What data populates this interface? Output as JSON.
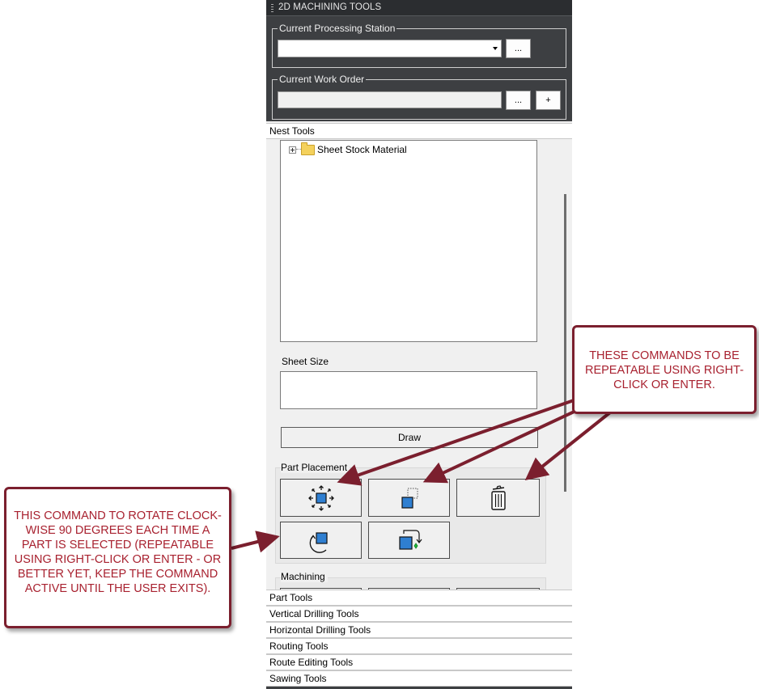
{
  "panel": {
    "title": "2D MACHINING TOOLS",
    "processing_station": {
      "label": "Current Processing Station",
      "value": "",
      "browse_label": "..."
    },
    "work_order": {
      "label": "Current Work Order",
      "value": "",
      "browse_label": "...",
      "add_label": "+"
    }
  },
  "nest_tools": {
    "header": "Nest Tools",
    "tree": {
      "items": [
        {
          "label": "Sheet Stock Material",
          "expanded": false
        }
      ]
    },
    "sheet_size_label": "Sheet Size",
    "sheet_size_value": "",
    "draw_label": "Draw",
    "part_placement": {
      "label": "Part Placement",
      "buttons": [
        {
          "icon": "move-part-icon"
        },
        {
          "icon": "align-part-icon"
        },
        {
          "icon": "delete-trash-icon"
        },
        {
          "icon": "rotate-part-icon"
        },
        {
          "icon": "swap-part-icon"
        }
      ]
    },
    "machining_label": "Machining"
  },
  "sections": [
    {
      "label": "Part Tools"
    },
    {
      "label": "Vertical Drilling Tools"
    },
    {
      "label": "Horizontal Drilling Tools"
    },
    {
      "label": "Routing Tools"
    },
    {
      "label": "Route Editing Tools"
    },
    {
      "label": "Sawing Tools"
    }
  ],
  "annotations": {
    "repeatable": "THESE COMMANDS TO BE REPEATABLE USING RIGHT-CLICK OR ENTER.",
    "rotate": "THIS COMMAND TO ROTATE CLOCK-WISE 90 DEGREES EACH TIME A PART IS SELECTED (REPEATABLE USING RIGHT-CLICK OR ENTER - OR BETTER YET, KEEP THE COMMAND ACTIVE UNTIL THE USER EXITS)."
  },
  "colors": {
    "callout_border": "#7b1f2e",
    "callout_text": "#a8212f",
    "arrow": "#7b1f2e",
    "icon_blue": "#2f7fd1",
    "dark_panel": "#3d3f42"
  }
}
